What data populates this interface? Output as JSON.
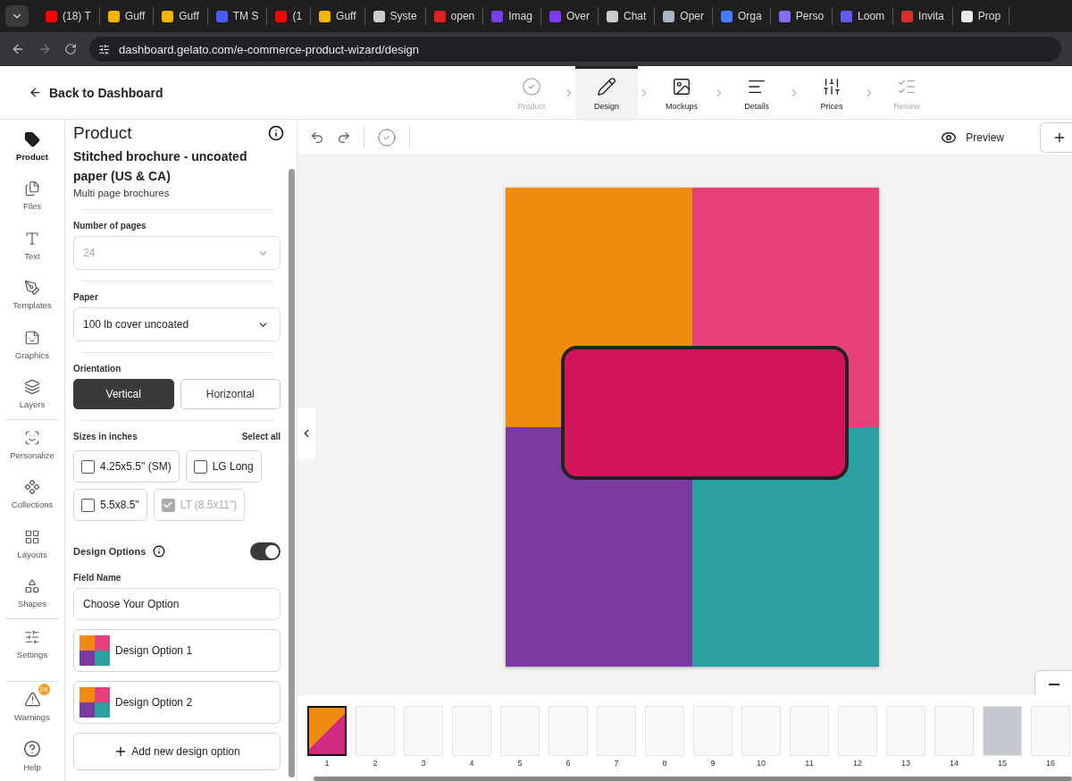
{
  "browser": {
    "tabs": [
      {
        "title": "(18) T",
        "color": "#ff0000"
      },
      {
        "title": "Guff",
        "color": "#f5b400"
      },
      {
        "title": "Guff",
        "color": "#f5b400"
      },
      {
        "title": "TM S",
        "color": "#4a5cff"
      },
      {
        "title": "(1",
        "color": "#ff0000"
      },
      {
        "title": "Guff",
        "color": "#f5b400"
      },
      {
        "title": "Syste",
        "color": "#cccccc"
      },
      {
        "title": "open",
        "color": "#e02020"
      },
      {
        "title": "Imag",
        "color": "#7b3cf0"
      },
      {
        "title": "Over",
        "color": "#7b3cf0"
      },
      {
        "title": "Chat",
        "color": "#cccccc"
      },
      {
        "title": "Oper",
        "color": "#aab4c8"
      },
      {
        "title": "Orga",
        "color": "#4a7cff"
      },
      {
        "title": "Perso",
        "color": "#8a6cf0"
      },
      {
        "title": "Loom",
        "color": "#625df5"
      },
      {
        "title": "Invita",
        "color": "#d93025"
      },
      {
        "title": "Prop",
        "color": "#e8e8e8"
      }
    ],
    "url": "dashboard.gelato.com/e-commerce-product-wizard/design"
  },
  "header": {
    "back": "Back to Dashboard",
    "steps": [
      {
        "label": "Product",
        "selected": false,
        "disabled": true
      },
      {
        "label": "Design",
        "selected": true,
        "disabled": false
      },
      {
        "label": "Mockups",
        "selected": false,
        "disabled": false
      },
      {
        "label": "Details",
        "selected": false,
        "disabled": false
      },
      {
        "label": "Prices",
        "selected": false,
        "disabled": false
      },
      {
        "label": "Review",
        "selected": false,
        "disabled": true
      }
    ]
  },
  "rail": {
    "items": [
      {
        "label": "Product",
        "selected": true
      },
      {
        "label": "Files",
        "selected": false
      },
      {
        "label": "Text",
        "selected": false
      },
      {
        "label": "Templates",
        "selected": false
      },
      {
        "label": "Graphics",
        "selected": false
      },
      {
        "label": "Layers",
        "selected": false
      },
      {
        "label": "Personalize",
        "selected": false
      },
      {
        "label": "Collections",
        "selected": false
      },
      {
        "label": "Layouts",
        "selected": false
      },
      {
        "label": "Shapes",
        "selected": false
      },
      {
        "label": "Settings",
        "selected": false
      }
    ],
    "warnings": {
      "label": "Warnings",
      "badge": "24"
    },
    "help": "Help"
  },
  "panel": {
    "title": "Product",
    "product_name": "Stitched brochure - uncoated paper (US & CA)",
    "product_type": "Multi page brochures",
    "pages": {
      "label": "Number of pages",
      "value": "24",
      "disabled": true
    },
    "paper": {
      "label": "Paper",
      "value": "100 lb cover uncoated",
      "disabled": false
    },
    "orientation": {
      "label": "Orientation",
      "options": [
        {
          "label": "Vertical",
          "selected": true
        },
        {
          "label": "Horizontal",
          "selected": false
        }
      ]
    },
    "sizes": {
      "label": "Sizes in inches",
      "select_all": "Select all",
      "options": [
        {
          "label": "4.25x5.5\" (SM)",
          "checked": false,
          "disabled": false
        },
        {
          "label": "LG Long",
          "checked": false,
          "disabled": false
        },
        {
          "label": "5.5x8.5\"",
          "checked": false,
          "disabled": false
        },
        {
          "label": "LT (8.5x11\")",
          "checked": true,
          "disabled": true
        }
      ]
    },
    "design_options": {
      "label": "Design Options",
      "on": true,
      "field_label": "Field Name",
      "field_value": "Choose Your Option",
      "options": [
        "Design Option 1",
        "Design Option 2"
      ],
      "add": "Add new design option"
    }
  },
  "toolbar": {
    "preview": "Preview"
  },
  "thumbnails": [
    {
      "number": "1",
      "kind": "cover",
      "selected": true
    },
    {
      "number": "2",
      "kind": "line-art",
      "selected": false
    },
    {
      "number": "3",
      "kind": "line-art",
      "selected": false
    },
    {
      "number": "4",
      "kind": "line-art",
      "selected": false
    },
    {
      "number": "5",
      "kind": "line-art",
      "selected": false
    },
    {
      "number": "6",
      "kind": "line-art",
      "selected": false
    },
    {
      "number": "7",
      "kind": "line-art",
      "selected": false
    },
    {
      "number": "8",
      "kind": "line-art",
      "selected": false
    },
    {
      "number": "9",
      "kind": "line-art",
      "selected": false
    },
    {
      "number": "10",
      "kind": "line-art",
      "selected": false
    },
    {
      "number": "11",
      "kind": "line-art",
      "selected": false
    },
    {
      "number": "12",
      "kind": "line-art",
      "selected": false
    },
    {
      "number": "13",
      "kind": "line-art",
      "selected": false
    },
    {
      "number": "14",
      "kind": "line-art",
      "selected": false
    },
    {
      "number": "15",
      "kind": "blank",
      "selected": false
    },
    {
      "number": "16",
      "kind": "line-art",
      "selected": false
    }
  ]
}
